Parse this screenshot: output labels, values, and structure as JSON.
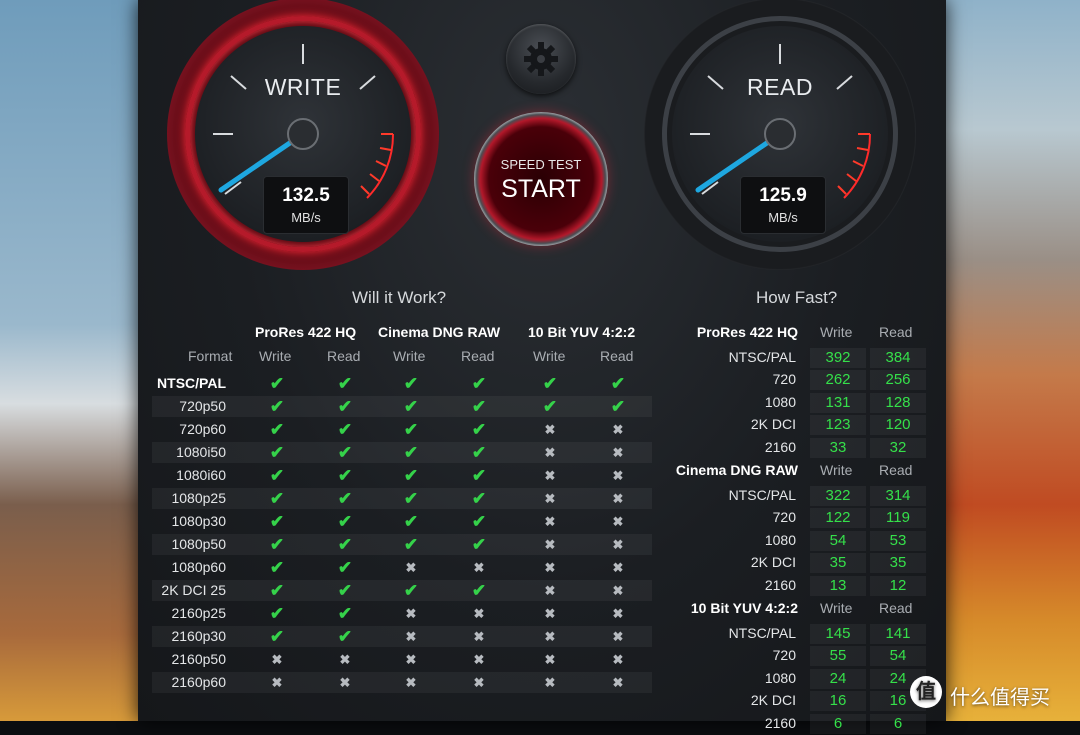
{
  "write_gauge": {
    "title": "WRITE",
    "value": "132.5",
    "unit": "MB/s"
  },
  "read_gauge": {
    "title": "READ",
    "value": "125.9",
    "unit": "MB/s"
  },
  "start_button": {
    "subtitle": "SPEED TEST",
    "label": "START"
  },
  "settings_icon": "gear-icon",
  "will_it_work": {
    "title": "Will it Work?",
    "format_header": "Format",
    "groups": [
      {
        "name": "ProRes 422 HQ",
        "cols": [
          "Write",
          "Read"
        ]
      },
      {
        "name": "Cinema DNG RAW",
        "cols": [
          "Write",
          "Read"
        ]
      },
      {
        "name": "10 Bit YUV 4:2:2",
        "cols": [
          "Write",
          "Read"
        ]
      }
    ],
    "rows": [
      {
        "format": "NTSC/PAL",
        "cells": [
          1,
          1,
          1,
          1,
          1,
          1
        ]
      },
      {
        "format": "720p50",
        "cells": [
          1,
          1,
          1,
          1,
          1,
          1
        ]
      },
      {
        "format": "720p60",
        "cells": [
          1,
          1,
          1,
          1,
          0,
          0
        ]
      },
      {
        "format": "1080i50",
        "cells": [
          1,
          1,
          1,
          1,
          0,
          0
        ]
      },
      {
        "format": "1080i60",
        "cells": [
          1,
          1,
          1,
          1,
          0,
          0
        ]
      },
      {
        "format": "1080p25",
        "cells": [
          1,
          1,
          1,
          1,
          0,
          0
        ]
      },
      {
        "format": "1080p30",
        "cells": [
          1,
          1,
          1,
          1,
          0,
          0
        ]
      },
      {
        "format": "1080p50",
        "cells": [
          1,
          1,
          1,
          1,
          0,
          0
        ]
      },
      {
        "format": "1080p60",
        "cells": [
          1,
          1,
          0,
          0,
          0,
          0
        ]
      },
      {
        "format": "2K DCI 25",
        "cells": [
          1,
          1,
          1,
          1,
          0,
          0
        ]
      },
      {
        "format": "2160p25",
        "cells": [
          1,
          1,
          0,
          0,
          0,
          0
        ]
      },
      {
        "format": "2160p30",
        "cells": [
          1,
          1,
          0,
          0,
          0,
          0
        ]
      },
      {
        "format": "2160p50",
        "cells": [
          0,
          0,
          0,
          0,
          0,
          0
        ]
      },
      {
        "format": "2160p60",
        "cells": [
          0,
          0,
          0,
          0,
          0,
          0
        ]
      }
    ]
  },
  "how_fast": {
    "title": "How Fast?",
    "groups": [
      {
        "name": "ProRes 422 HQ",
        "write_label": "Write",
        "read_label": "Read",
        "rows": [
          {
            "format": "NTSC/PAL",
            "write": "392",
            "read": "384"
          },
          {
            "format": "720",
            "write": "262",
            "read": "256"
          },
          {
            "format": "1080",
            "write": "131",
            "read": "128"
          },
          {
            "format": "2K DCI",
            "write": "123",
            "read": "120"
          },
          {
            "format": "2160",
            "write": "33",
            "read": "32"
          }
        ]
      },
      {
        "name": "Cinema DNG RAW",
        "write_label": "Write",
        "read_label": "Read",
        "rows": [
          {
            "format": "NTSC/PAL",
            "write": "322",
            "read": "314"
          },
          {
            "format": "720",
            "write": "122",
            "read": "119"
          },
          {
            "format": "1080",
            "write": "54",
            "read": "53"
          },
          {
            "format": "2K DCI",
            "write": "35",
            "read": "35"
          },
          {
            "format": "2160",
            "write": "13",
            "read": "12"
          }
        ]
      },
      {
        "name": "10 Bit YUV 4:2:2",
        "write_label": "Write",
        "read_label": "Read",
        "rows": [
          {
            "format": "NTSC/PAL",
            "write": "145",
            "read": "141"
          },
          {
            "format": "720",
            "write": "55",
            "read": "54"
          },
          {
            "format": "1080",
            "write": "24",
            "read": "24"
          },
          {
            "format": "2K DCI",
            "write": "16",
            "read": "16"
          },
          {
            "format": "2160",
            "write": "6",
            "read": "6"
          }
        ]
      }
    ]
  },
  "colors": {
    "check": "#35d24a",
    "value": "#35e04a",
    "accent_red": "#b51a2a",
    "needle": "#1ea7e0"
  },
  "watermark": {
    "logo": "值",
    "text": "什么值得买"
  }
}
